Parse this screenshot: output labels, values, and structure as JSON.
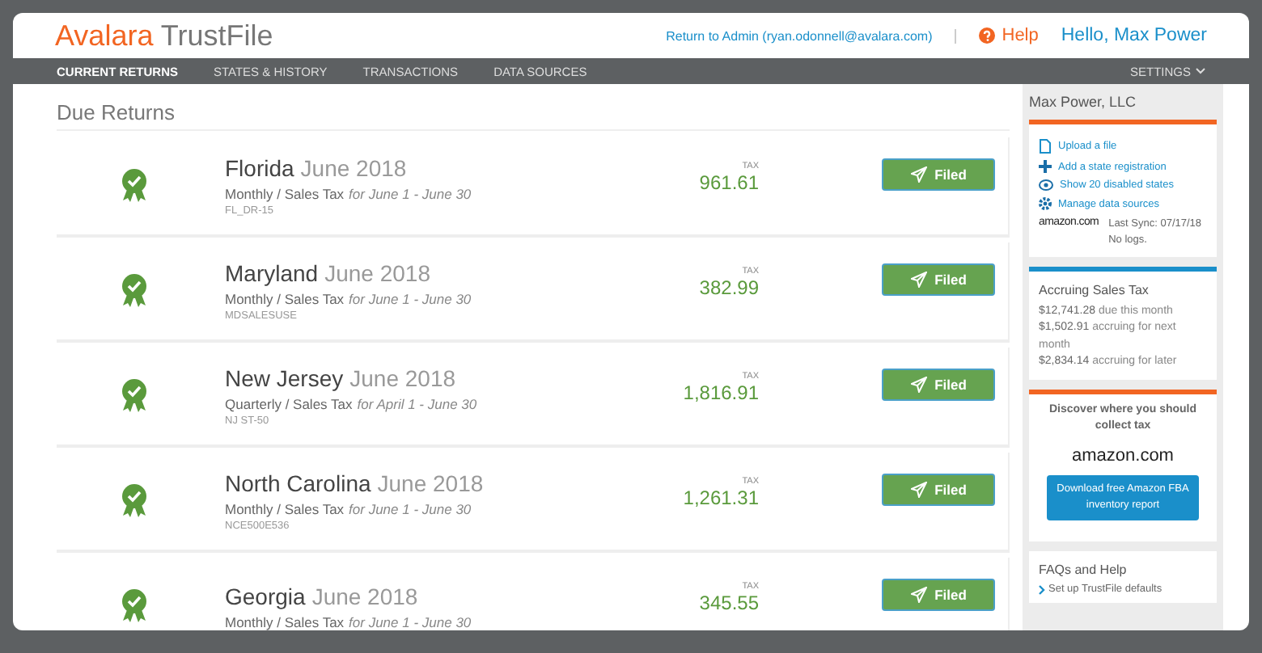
{
  "header": {
    "logo": {
      "brand": "Avalara",
      "product": "TrustFile"
    },
    "admin_link": "Return to Admin (ryan.odonnell@avalara.com)",
    "help": "Help",
    "greeting": "Hello, Max Power"
  },
  "nav": {
    "tabs": [
      {
        "label": "CURRENT RETURNS",
        "selected": true
      },
      {
        "label": "STATES & HISTORY",
        "selected": false
      },
      {
        "label": "TRANSACTIONS",
        "selected": false
      },
      {
        "label": "DATA SOURCES",
        "selected": false
      }
    ],
    "settings": "SETTINGS"
  },
  "main": {
    "title": "Due Returns",
    "returns": [
      {
        "state": "Florida",
        "period": "June 2018",
        "frequency": "Monthly / Sales Tax",
        "range": "for June 1 - June 30",
        "form": "FL_DR-15",
        "tax_label": "TAX",
        "tax": "961.61",
        "status": "Filed"
      },
      {
        "state": "Maryland",
        "period": "June 2018",
        "frequency": "Monthly / Sales Tax",
        "range": "for June 1 - June 30",
        "form": "MDSALESUSE",
        "tax_label": "TAX",
        "tax": "382.99",
        "status": "Filed"
      },
      {
        "state": "New Jersey",
        "period": "June 2018",
        "frequency": "Quarterly / Sales Tax",
        "range": "for April 1 - June 30",
        "form": "NJ ST-50",
        "tax_label": "TAX",
        "tax": "1,816.91",
        "status": "Filed"
      },
      {
        "state": "North Carolina",
        "period": "June 2018",
        "frequency": "Monthly / Sales Tax",
        "range": "for June 1 - June 30",
        "form": "NCE500E536",
        "tax_label": "TAX",
        "tax": "1,261.31",
        "status": "Filed"
      },
      {
        "state": "Georgia",
        "period": "June 2018",
        "frequency": "Monthly / Sales Tax",
        "range": "for June 1 - June 30",
        "tax_label": "TAX",
        "tax": "345.55",
        "status": "Filed"
      }
    ]
  },
  "sidebar": {
    "company": "Max Power, LLC",
    "actions": [
      {
        "kind": "file",
        "label": "Upload a file"
      },
      {
        "kind": "plus",
        "label": "Add a state registration"
      },
      {
        "kind": "eye",
        "label": "Show 20 disabled states"
      },
      {
        "kind": "gear",
        "label": "Manage data sources"
      }
    ],
    "sync": {
      "logo": "amazon.com",
      "last_sync": "Last Sync: 07/17/18",
      "logs": "No logs."
    },
    "accruing": {
      "title": "Accruing Sales Tax",
      "lines": [
        {
          "amount": "$12,741.28",
          "text": "due this month"
        },
        {
          "amount": "$1,502.91",
          "text": "accruing for next month"
        },
        {
          "amount": "$2,834.14",
          "text": "accruing for later"
        }
      ]
    },
    "promo": {
      "text": "Discover where you should collect tax",
      "logo": "amazon.com",
      "button": "Download free Amazon FBA inventory report"
    },
    "faq": {
      "title": "FAQs and Help",
      "links": [
        "Set up TrustFile defaults"
      ]
    }
  }
}
